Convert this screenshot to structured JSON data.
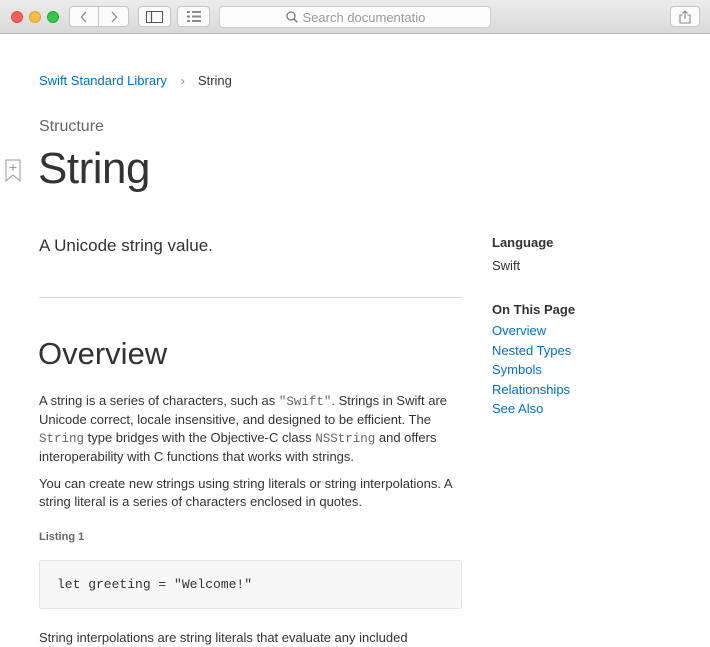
{
  "toolbar": {
    "search_placeholder": "Search documentation"
  },
  "breadcrumb": {
    "parent": "Swift Standard Library",
    "separator": "›",
    "current": "String"
  },
  "eyebrow": "Structure",
  "title": "String",
  "abstract": "A Unicode string value.",
  "overview": {
    "heading": "Overview",
    "para1": [
      "A string is a series of characters, such as ",
      "\"Swift\"",
      ". Strings in Swift are Unicode correct, locale insensitive, and designed to be efficient. The ",
      "String",
      " type bridges with the Objective-C class ",
      "NSString",
      " and offers interoperability with C functions that works with strings."
    ],
    "para2": "You can create new strings using string literals or string interpolations. A string literal is a series of characters enclosed in quotes.",
    "listing_label": "Listing 1",
    "listing_code": "let greeting = \"Welcome!\"",
    "para3": "String interpolations are string literals that evaluate any included"
  },
  "aside": {
    "language_heading": "Language",
    "language_value": "Swift",
    "on_this_page_heading": "On This Page",
    "links": [
      "Overview",
      "Nested Types",
      "Symbols",
      "Relationships",
      "See Also"
    ]
  },
  "colors": {
    "link": "#0070c9",
    "text": "#333333",
    "secondary": "#666666",
    "code_bg": "#f7f7f7"
  },
  "icons": {
    "close": "close-dot-icon",
    "minimize": "minimize-dot-icon",
    "maximize": "maximize-dot-icon",
    "back": "chevron-left-icon",
    "forward": "chevron-right-icon",
    "sidebar": "sidebar-icon",
    "grid": "grid-icon",
    "search": "search-icon",
    "share": "share-icon",
    "bookmark": "bookmark-icon"
  }
}
